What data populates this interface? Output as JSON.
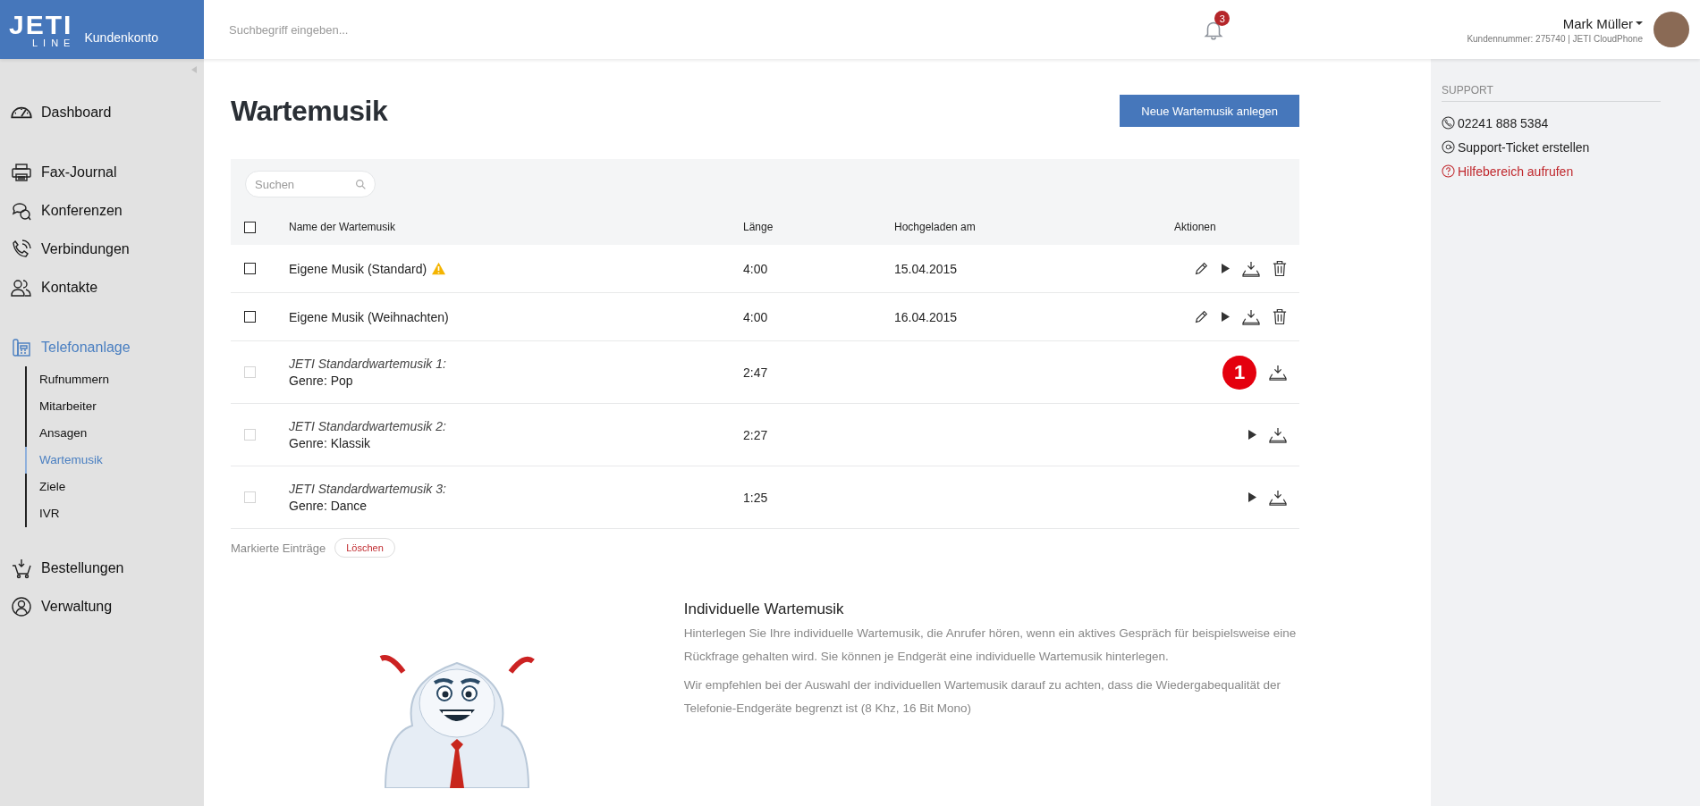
{
  "header": {
    "logo_main": "JETI",
    "logo_sub": "LINE",
    "portal_label": "Kundenkonto",
    "search": {
      "placeholder": "Suchbegriff eingeben..."
    },
    "notification_count": "3",
    "user": {
      "name": "Mark Müller",
      "customer_line": "Kundennummer: 275740 | JETI CloudPhone"
    }
  },
  "sidebar": {
    "groups": [
      {
        "items": [
          {
            "label": "Dashboard",
            "selected": false
          }
        ]
      },
      {
        "items": [
          {
            "label": "Fax-Journal",
            "selected": false
          },
          {
            "label": "Konferenzen",
            "selected": false
          },
          {
            "label": "Verbindungen",
            "selected": false
          },
          {
            "label": "Kontakte",
            "selected": false
          }
        ]
      },
      {
        "items": [
          {
            "label": "Telefonanlage",
            "selected": true,
            "children": [
              {
                "label": "Rufnummern",
                "selected": false
              },
              {
                "label": "Mitarbeiter",
                "selected": false
              },
              {
                "label": "Ansagen",
                "selected": false
              },
              {
                "label": "Wartemusik",
                "selected": true
              },
              {
                "label": "Ziele",
                "selected": false
              },
              {
                "label": "IVR",
                "selected": false
              }
            ]
          }
        ]
      },
      {
        "items": [
          {
            "label": "Bestellungen",
            "selected": false
          },
          {
            "label": "Verwaltung",
            "selected": false
          }
        ]
      }
    ]
  },
  "page": {
    "title": "Wartemusik",
    "new_button": "Neue Wartemusik anlegen"
  },
  "table": {
    "search": {
      "placeholder": "Suchen"
    },
    "columns": [
      "Name der Wartemusik",
      "Länge",
      "Hochgeladen am",
      "Aktionen"
    ],
    "select_all": {
      "checked": false
    },
    "rows": [
      {
        "kind": "custom",
        "name": "Eigene Musik (Standard)",
        "warning": true,
        "length": "4:00",
        "uploaded": "15.04.2015",
        "checked": false,
        "disabled": false,
        "editable": true,
        "playable": true,
        "downloadable": true,
        "deletable": true
      },
      {
        "kind": "custom",
        "name": "Eigene Musik (Weihnachten)",
        "warning": false,
        "length": "4:00",
        "uploaded": "16.04.2015",
        "checked": false,
        "disabled": false,
        "editable": true,
        "playable": true,
        "downloadable": true,
        "deletable": true
      },
      {
        "kind": "standard",
        "name": "JETI Standardwartemusik 1:",
        "genre": "Genre: Pop",
        "length": "2:47",
        "checked": false,
        "disabled": true,
        "callout": "1",
        "editable": false,
        "playable": false,
        "downloadable": true,
        "deletable": false
      },
      {
        "kind": "standard",
        "name": "JETI Standardwartemusik 2:",
        "genre": "Genre: Klassik",
        "length": "2:27",
        "checked": false,
        "disabled": true,
        "editable": false,
        "playable": true,
        "downloadable": true,
        "deletable": false
      },
      {
        "kind": "standard",
        "name": "JETI Standardwartemusik 3:",
        "genre": "Genre: Dance",
        "length": "1:25",
        "checked": false,
        "disabled": true,
        "editable": false,
        "playable": true,
        "downloadable": true,
        "deletable": false
      }
    ],
    "bulk_label": "Markierte Einträge",
    "bulk_delete": "Löschen"
  },
  "info": {
    "heading": "Individuelle Wartemusik",
    "paragraphs": [
      "Hinterlegen Sie Ihre individuelle Wartemusik, die Anrufer hören, wenn ein aktives Gespräch für beispielsweise eine Rückfrage gehalten wird. Sie können je Endgerät eine individuelle Wartemusik hinterlegen.",
      "Wir empfehlen bei der Auswahl der individuellen Wartemusik darauf zu achten, dass die Wiedergabequalität der Telefonie-Endgeräte begrenzt ist (8 Khz, 16 Bit Mono)"
    ]
  },
  "support": {
    "heading": "SUPPORT",
    "items": [
      {
        "kind": "phone",
        "label": "02241 888 5384"
      },
      {
        "kind": "ticket",
        "label": "Support-Ticket erstellen"
      },
      {
        "kind": "help",
        "label": "Hilfebereich aufrufen"
      }
    ]
  }
}
